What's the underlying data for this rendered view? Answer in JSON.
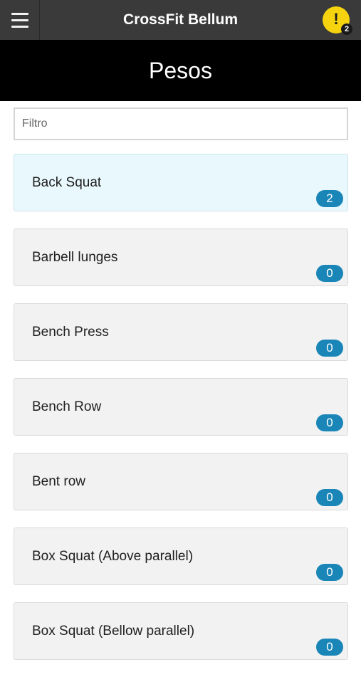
{
  "topbar": {
    "title": "CrossFit Bellum",
    "alert_icon": "!",
    "alert_count": "2"
  },
  "header": {
    "title": "Pesos"
  },
  "filter": {
    "placeholder": "Filtro",
    "value": ""
  },
  "items": [
    {
      "label": "Back Squat",
      "count": "2",
      "active": true
    },
    {
      "label": "Barbell lunges",
      "count": "0"
    },
    {
      "label": "Bench Press",
      "count": "0"
    },
    {
      "label": "Bench Row",
      "count": "0"
    },
    {
      "label": "Bent row",
      "count": "0"
    },
    {
      "label": "Box Squat (Above parallel)",
      "count": "0"
    },
    {
      "label": "Box Squat (Bellow parallel)",
      "count": "0"
    }
  ],
  "colors": {
    "topbar": "#3a3a3a",
    "header": "#000000",
    "alert": "#f5d40f",
    "badge": "#1a86b8",
    "active_item": "#e9f8fd",
    "item": "#f2f2f2"
  }
}
